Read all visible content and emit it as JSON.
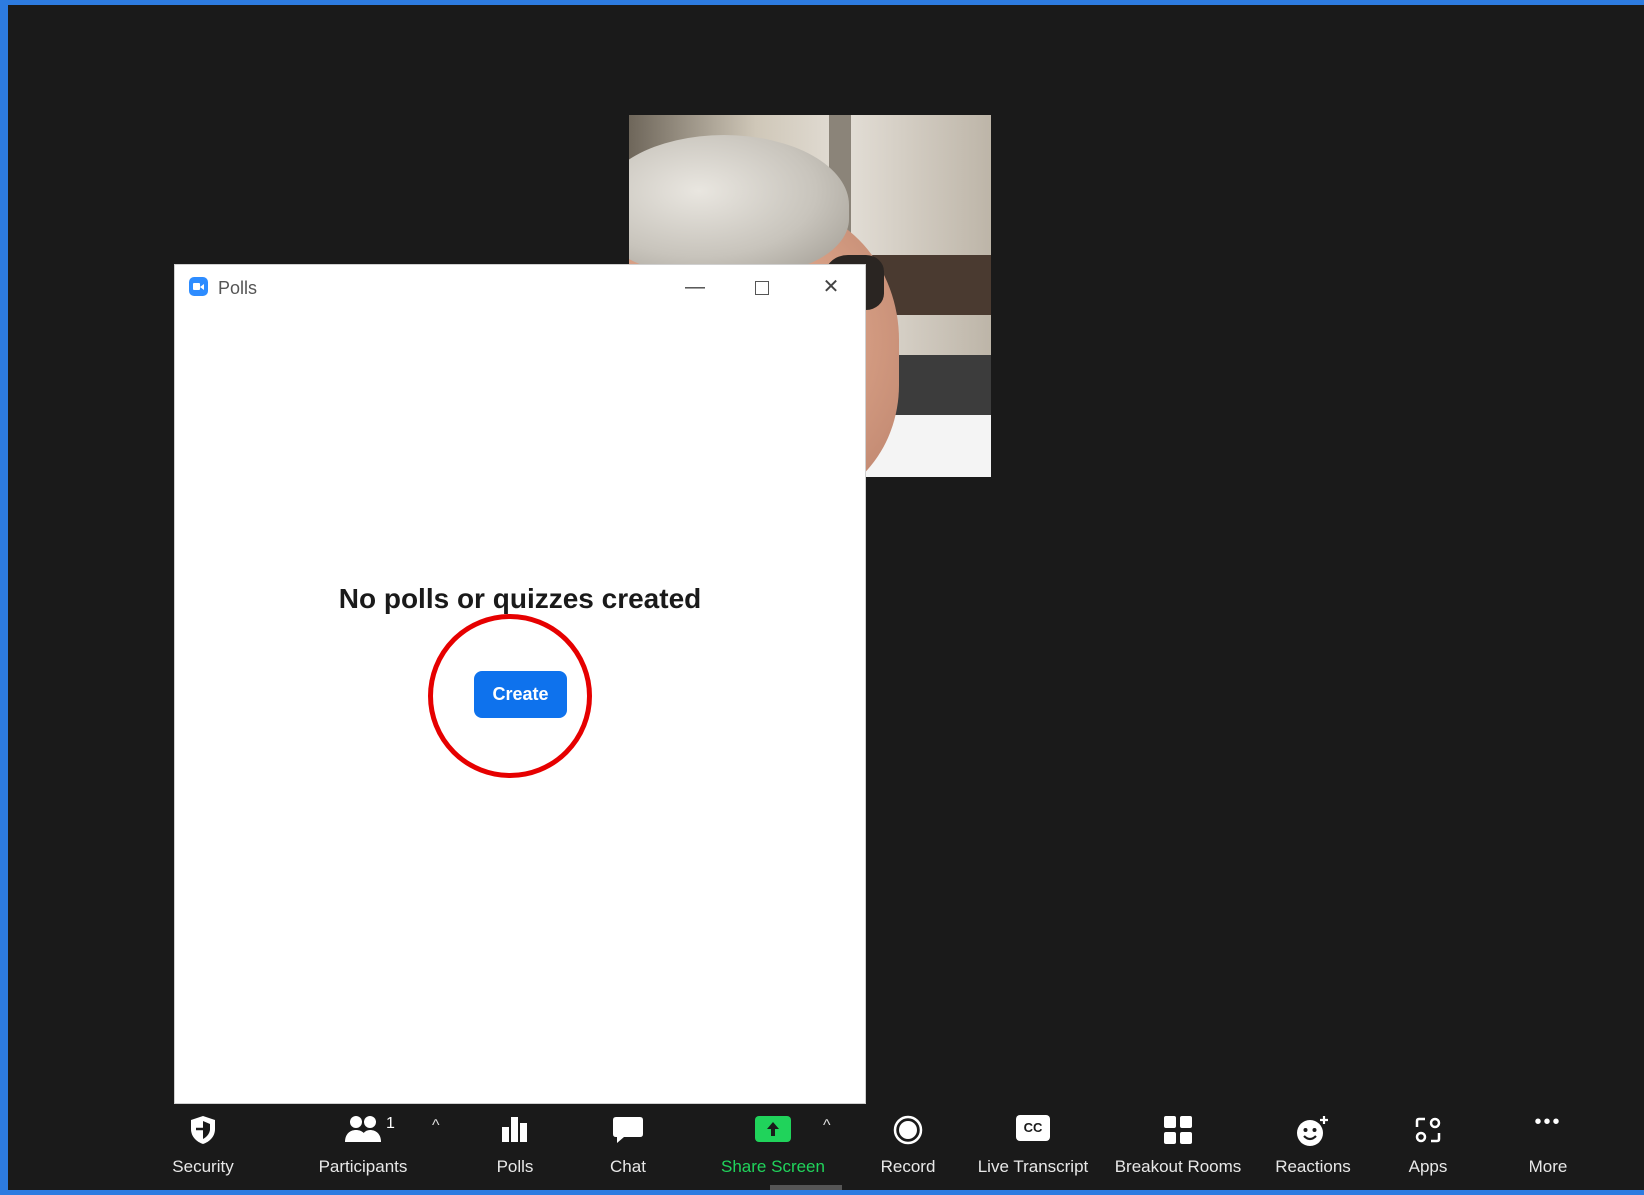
{
  "polls_window": {
    "title": "Polls",
    "minimize": "—",
    "close": "✕",
    "empty_message": "No polls or quizzes created",
    "create_label": "Create"
  },
  "toolbar": {
    "security": "Security",
    "participants": "Participants",
    "participants_count": "1",
    "polls": "Polls",
    "chat": "Chat",
    "share_screen": "Share Screen",
    "record": "Record",
    "live_transcript": "Live Transcript",
    "cc_badge": "CC",
    "breakout_rooms": "Breakout Rooms",
    "reactions": "Reactions",
    "apps": "Apps",
    "more": "More",
    "more_glyph": "•••",
    "caret": "^"
  },
  "colors": {
    "accent_blue": "#0e72ed",
    "share_green": "#20d35b",
    "highlight_red": "#e60000",
    "background": "#1a1a1a"
  }
}
